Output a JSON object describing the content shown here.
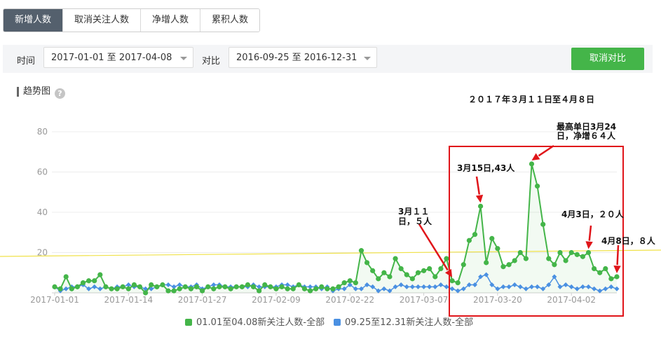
{
  "tabs": [
    {
      "label": "新增人数",
      "active": true
    },
    {
      "label": "取消关注人数",
      "active": false
    },
    {
      "label": "净增人数",
      "active": false
    },
    {
      "label": "累积人数",
      "active": false
    }
  ],
  "filter": {
    "time_label": "时间",
    "time_range": "2017-01-01 至 2017-04-08",
    "compare_label": "对比",
    "compare_range": "2016-09-25 至 2016-12-31",
    "cancel_compare": "取消对比"
  },
  "section": {
    "title": "趋势图",
    "help": "?"
  },
  "legend": {
    "series1": "01.01至04.08新关注人数-全部",
    "series2": "09.25至12.31新关注人数-全部"
  },
  "annotations": {
    "range_title": "２０１７年３月１１日至４月８日",
    "peak_line1": "最高单日3月24",
    "peak_line2": "日，净增６４人",
    "mar15": "3月15日,43人",
    "mar11_line1": "3月１１",
    "mar11_line2": "日，５人",
    "apr3": "4月3日，２０人",
    "apr8": "4月8日，８人"
  },
  "colors": {
    "series1": "#44b549",
    "series2": "#4a90e2",
    "highlight": "#e0151a",
    "active_tab": "#54606d"
  },
  "chart_data": {
    "type": "line",
    "yticks": [
      0,
      20,
      40,
      60,
      80
    ],
    "ylim": [
      0,
      80
    ],
    "xticks": [
      "2017-01-01",
      "2017-01-14",
      "2017-01-27",
      "2017-02-09",
      "2017-02-22",
      "2017-03-07",
      "2017-03-20",
      "2017-04-02"
    ],
    "series": [
      {
        "name": "01.01至04.08新关注人数-全部",
        "color": "#44b549",
        "values": [
          3,
          2,
          8,
          2,
          3,
          5,
          6,
          6,
          9,
          3,
          2,
          2,
          3,
          2,
          4,
          3,
          0,
          4,
          3,
          4,
          1,
          1,
          2,
          3,
          2,
          3,
          1,
          3,
          2,
          3,
          3,
          2,
          3,
          3,
          4,
          3,
          1,
          4,
          3,
          2,
          3,
          2,
          2,
          4,
          2,
          1,
          2,
          3,
          2,
          2,
          3,
          5,
          6,
          5,
          21,
          15,
          11,
          7,
          10,
          8,
          17,
          12,
          9,
          7,
          10,
          11,
          12,
          8,
          12,
          17,
          6,
          5,
          14,
          26,
          29,
          43,
          15,
          27,
          22,
          13,
          14,
          16,
          20,
          17,
          64,
          53,
          34,
          17,
          14,
          20,
          16,
          20,
          19,
          18,
          20,
          12,
          10,
          12,
          7,
          8
        ]
      },
      {
        "name": "09.25至12.31新关注人数-全部",
        "color": "#4a90e2",
        "values": [
          3,
          1,
          2,
          3,
          3,
          4,
          2,
          3,
          2,
          3,
          2,
          3,
          3,
          4,
          3,
          3,
          2,
          2,
          3,
          4,
          4,
          3,
          4,
          3,
          3,
          4,
          2,
          3,
          4,
          4,
          3,
          3,
          3,
          3,
          3,
          4,
          3,
          3,
          3,
          3,
          4,
          4,
          3,
          4,
          3,
          3,
          3,
          2,
          3,
          1,
          2,
          2,
          4,
          2,
          2,
          4,
          3,
          1,
          2,
          1,
          3,
          4,
          3,
          3,
          3,
          3,
          3,
          3,
          4,
          3,
          2,
          1,
          2,
          4,
          4,
          8,
          9,
          4,
          2,
          3,
          3,
          4,
          3,
          2,
          3,
          3,
          2,
          4,
          8,
          3,
          4,
          3,
          2,
          3,
          3,
          2,
          1,
          2,
          3,
          2
        ]
      }
    ]
  }
}
